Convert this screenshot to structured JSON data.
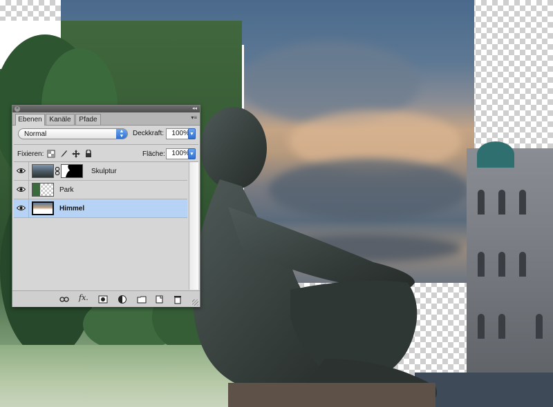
{
  "panel": {
    "tabs": [
      {
        "label": "Ebenen",
        "active": true
      },
      {
        "label": "Kanäle",
        "active": false
      },
      {
        "label": "Pfade",
        "active": false
      }
    ],
    "blend_mode": "Normal",
    "opacity_label": "Deckkraft:",
    "opacity_value": "100%",
    "lock_label": "Fixieren:",
    "fill_label": "Fläche:",
    "fill_value": "100%",
    "layers": [
      {
        "name": "Skulptur",
        "visible": true,
        "has_mask": true,
        "selected": false
      },
      {
        "name": "Park",
        "visible": true,
        "has_mask": false,
        "selected": false
      },
      {
        "name": "Himmel",
        "visible": true,
        "has_mask": false,
        "selected": true
      }
    ],
    "bottom_icons": [
      "link-layers-icon",
      "layer-style-fx-icon",
      "add-mask-icon",
      "adjustment-layer-icon",
      "new-group-icon",
      "new-layer-icon",
      "delete-layer-icon"
    ],
    "selection_color": "#b6d3f6",
    "accent_color": "#2f6fd1"
  }
}
